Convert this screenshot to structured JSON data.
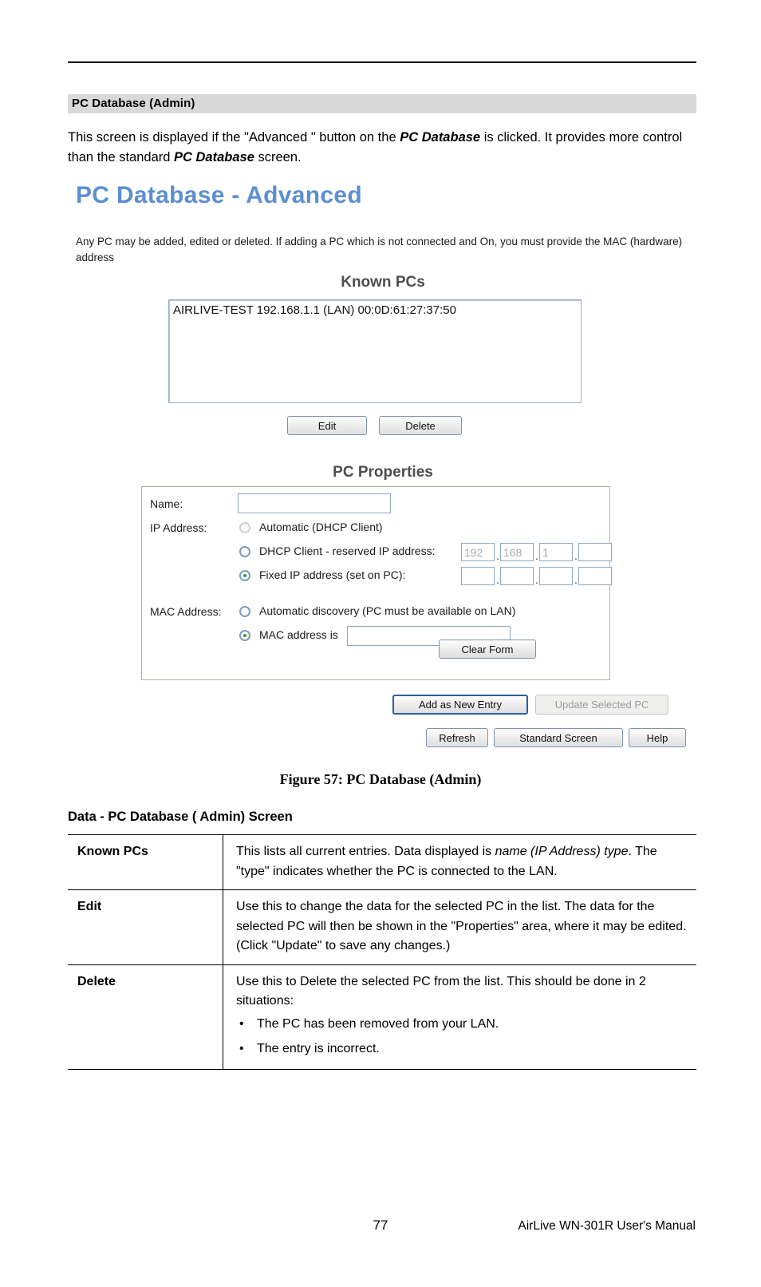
{
  "section": {
    "heading": "PC Database (Admin)",
    "intro_part1": "This screen is displayed if the \"Advanced \" button on the ",
    "intro_em1": "PC Database",
    "intro_part2": " is clicked. It provides more control than the standard ",
    "intro_em2": "PC Database",
    "intro_part3": " screen."
  },
  "figure": {
    "title": "PC Database - Advanced",
    "description": "Any PC may be added, edited or deleted. If adding a PC which is not connected and On, you must provide the MAC (hardware) address",
    "known_pcs": {
      "heading": "Known PCs",
      "entries": [
        "AIRLIVE-TEST 192.168.1.1 (LAN) 00:0D:61:27:37:50"
      ],
      "edit_label": "Edit",
      "delete_label": "Delete"
    },
    "pc_properties": {
      "heading": "PC Properties",
      "name_label": "Name:",
      "name_value": "",
      "ip_label": "IP Address:",
      "ip_option_automatic": "Automatic (DHCP Client)",
      "ip_option_dhcp_reserved": "DHCP Client - reserved IP address:",
      "ip_option_fixed": "Fixed IP address (set on PC):",
      "dhcp_reserved_ip": [
        "192",
        "168",
        "1",
        ""
      ],
      "fixed_ip": [
        "",
        "",
        "",
        ""
      ],
      "ip_selected": "fixed",
      "mac_label": "MAC Address:",
      "mac_option_auto": "Automatic discovery (PC must be available on LAN)",
      "mac_option_manual": "MAC address is",
      "mac_value": "",
      "mac_selected": "manual",
      "clear_form_label": "Clear Form"
    },
    "actions": {
      "add_label": "Add as New Entry",
      "update_label": "Update Selected PC",
      "refresh_label": "Refresh",
      "standard_screen_label": "Standard Screen",
      "help_label": "Help"
    },
    "accent_color": "#5b8fd0"
  },
  "caption": "Figure 57: PC Database (Admin)",
  "data_table": {
    "title": "Data - PC Database ( Admin) Screen",
    "rows": [
      {
        "key": "Known PCs",
        "text_part1": "This lists all current entries. Data displayed is ",
        "text_em1": "name (IP Address) type",
        "text_part2": ". The \"type\" indicates whether the PC is connected to the LAN."
      },
      {
        "key": "Edit",
        "text": "Use this to change the data for the selected PC in the list. The data for the selected PC will then be shown in the \"Properties\" area, where it may be edited. (Click \"Update\" to save any changes.)"
      },
      {
        "key": "Delete",
        "text": "Use this to Delete the selected PC from the list. This should be done in 2 situations:",
        "bullets": [
          "The PC has been removed from your LAN.",
          "The entry is incorrect."
        ]
      }
    ]
  },
  "footer": {
    "page_number": "77",
    "manual": "AirLive WN-301R User's Manual"
  }
}
